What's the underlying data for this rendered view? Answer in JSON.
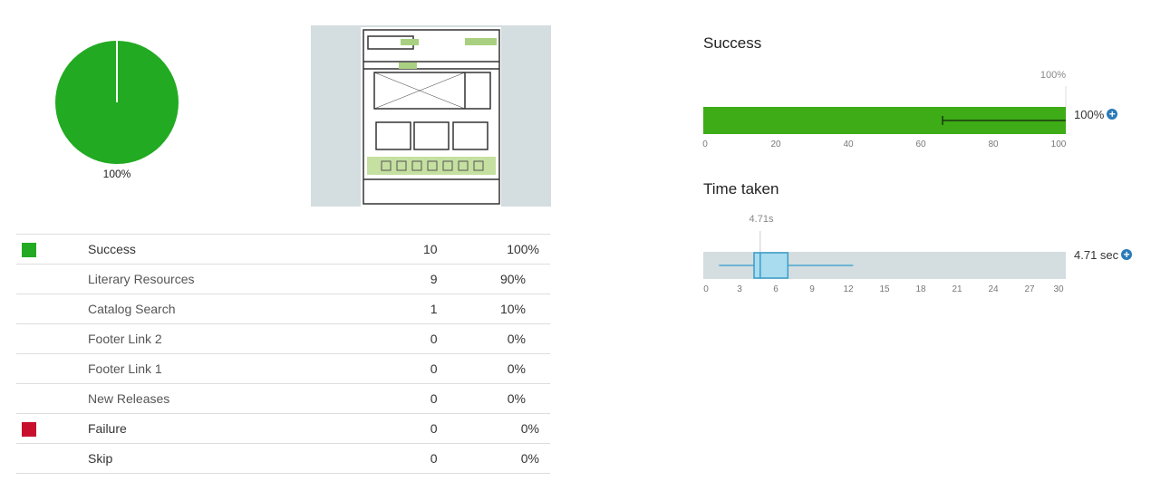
{
  "pie": {
    "label": "100%",
    "slices": [
      {
        "name": "Success",
        "value": 100,
        "color": "#22aa22"
      }
    ]
  },
  "table": {
    "rows": [
      {
        "label": "Success",
        "count": "10",
        "percent": "100%",
        "swatch": "#22aa22",
        "type": "main"
      },
      {
        "label": "Literary Resources",
        "count": "9",
        "percent": "90%",
        "type": "sub"
      },
      {
        "label": "Catalog Search",
        "count": "1",
        "percent": "10%",
        "type": "sub"
      },
      {
        "label": "Footer Link 2",
        "count": "0",
        "percent": "0%",
        "type": "sub"
      },
      {
        "label": "Footer Link 1",
        "count": "0",
        "percent": "0%",
        "type": "sub"
      },
      {
        "label": "New Releases",
        "count": "0",
        "percent": "0%",
        "type": "sub"
      },
      {
        "label": "Failure",
        "count": "0",
        "percent": "0%",
        "swatch": "#c8102e",
        "type": "main"
      },
      {
        "label": "Skip",
        "count": "0",
        "percent": "0%",
        "type": "main"
      }
    ]
  },
  "success_chart": {
    "title": "Success",
    "marker_label": "100%",
    "value_label": "100%",
    "value": 100,
    "error_low": 66,
    "error_high": 100,
    "ticks": [
      "0",
      "20",
      "40",
      "60",
      "80",
      "100"
    ],
    "color": "#3dac16"
  },
  "time_chart": {
    "title": "Time taken",
    "marker_label": "4.71s",
    "value_label": "4.71 sec",
    "min": 1.3,
    "q1": 4.2,
    "median": 4.71,
    "q3": 7.0,
    "max": 12.4,
    "ticks": [
      "0",
      "3",
      "6",
      "9",
      "12",
      "15",
      "18",
      "21",
      "24",
      "27",
      "30"
    ]
  }
}
